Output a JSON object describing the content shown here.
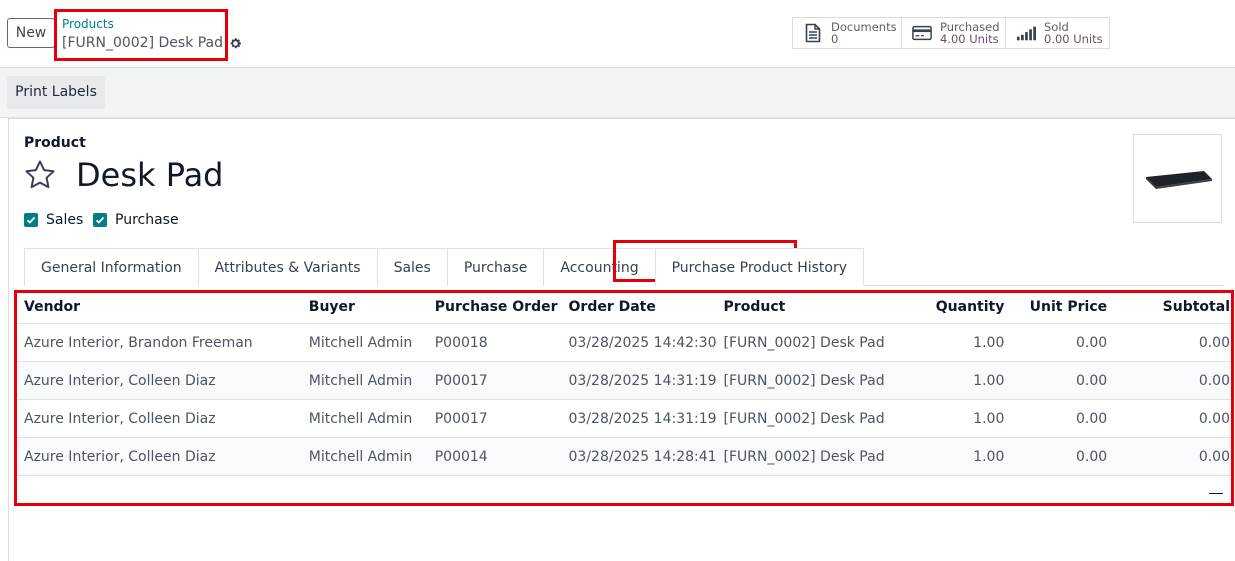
{
  "control": {
    "new_label": "New",
    "breadcrumb_parent": "Products",
    "breadcrumb_current": "[FURN_0002] Desk Pad"
  },
  "smart_buttons": [
    {
      "label": "Documents",
      "value": "0",
      "icon": "document-icon"
    },
    {
      "label": "Purchased",
      "value": "4.00 Units",
      "icon": "credit-card-icon"
    },
    {
      "label": "Sold",
      "value": "0.00 Units",
      "icon": "signal-bars-icon"
    }
  ],
  "actions": {
    "print_labels": "Print Labels"
  },
  "product": {
    "section_label": "Product",
    "name": "Desk Pad",
    "sales_label": "Sales",
    "purchase_label": "Purchase"
  },
  "tabs": [
    "General Information",
    "Attributes & Variants",
    "Sales",
    "Purchase",
    "Accounting",
    "Purchase Product History"
  ],
  "active_tab": "Purchase Product History",
  "table": {
    "headers": {
      "vendor": "Vendor",
      "buyer": "Buyer",
      "po": "Purchase Order",
      "date": "Order Date",
      "product": "Product",
      "qty": "Quantity",
      "price": "Unit Price",
      "subtotal": "Subtotal"
    },
    "rows": [
      {
        "vendor": "Azure Interior, Brandon Freeman",
        "buyer": "Mitchell Admin",
        "po": "P00018",
        "date": "03/28/2025 14:42:30",
        "product": "[FURN_0002] Desk Pad",
        "qty": "1.00",
        "price": "0.00",
        "subtotal": "0.00"
      },
      {
        "vendor": "Azure Interior, Colleen Diaz",
        "buyer": "Mitchell Admin",
        "po": "P00017",
        "date": "03/28/2025 14:31:19",
        "product": "[FURN_0002] Desk Pad",
        "qty": "1.00",
        "price": "0.00",
        "subtotal": "0.00"
      },
      {
        "vendor": "Azure Interior, Colleen Diaz",
        "buyer": "Mitchell Admin",
        "po": "P00017",
        "date": "03/28/2025 14:31:19",
        "product": "[FURN_0002] Desk Pad",
        "qty": "1.00",
        "price": "0.00",
        "subtotal": "0.00"
      },
      {
        "vendor": "Azure Interior, Colleen Diaz",
        "buyer": "Mitchell Admin",
        "po": "P00014",
        "date": "03/28/2025 14:28:41",
        "product": "[FURN_0002] Desk Pad",
        "qty": "1.00",
        "price": "0.00",
        "subtotal": "0.00"
      }
    ]
  },
  "colors": {
    "brand": "#714b67",
    "teal": "#017e84",
    "highlight": "#e3000b"
  }
}
